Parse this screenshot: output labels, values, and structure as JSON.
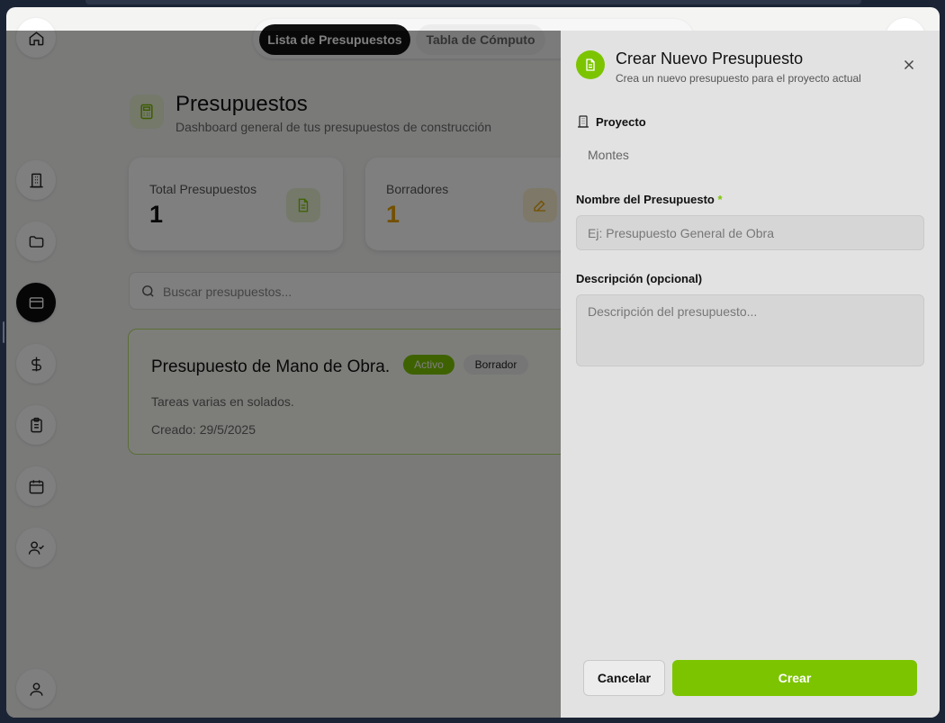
{
  "tabs": {
    "active": "Lista de Presupuestos",
    "inactive": "Tabla de Cómputo"
  },
  "sidebar": {
    "icons": [
      "home-icon",
      "building-icon",
      "folder-icon",
      "card-icon",
      "dollar-icon",
      "clipboard-icon",
      "calendar-icon",
      "user-check-icon",
      "user-icon"
    ],
    "active": "card-icon"
  },
  "header": {
    "title": "Presupuestos",
    "subtitle": "Dashboard general de tus presupuestos de construcción"
  },
  "stats": [
    {
      "label": "Total Presupuestos",
      "value": "1",
      "icon": "document-icon",
      "color": "#7cc400"
    },
    {
      "label": "Borradores",
      "value": "1",
      "icon": "edit-icon",
      "color": "#e6a000"
    }
  ],
  "search": {
    "placeholder": "Buscar presupuestos..."
  },
  "budget": {
    "title": "Presupuesto de Mano de Obra.",
    "badge_active": "Activo",
    "badge_draft": "Borrador",
    "description": "Tareas varias en solados.",
    "created": "Creado: 29/5/2025"
  },
  "dialog": {
    "title": "Crear Nuevo Presupuesto",
    "subtitle": "Crea un nuevo presupuesto para el proyecto actual",
    "project_label": "Proyecto",
    "project_value": "Montes",
    "name_label": "Nombre del Presupuesto",
    "name_required": "*",
    "name_placeholder": "Ej: Presupuesto General de Obra",
    "desc_label": "Descripción (opcional)",
    "desc_placeholder": "Descripción del presupuesto...",
    "cancel": "Cancelar",
    "create": "Crear"
  },
  "colors": {
    "accent": "#7cc400",
    "warning": "#e6a000"
  }
}
